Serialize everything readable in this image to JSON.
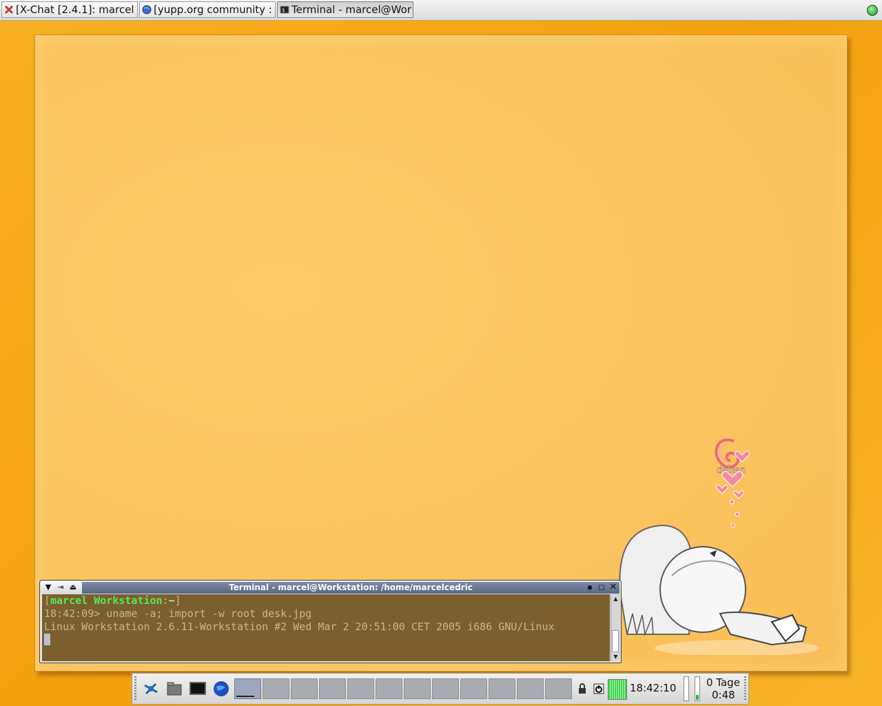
{
  "taskbar": {
    "tasks": [
      {
        "label": "[X-Chat [2.4.1]: marcel",
        "icon": "xchat-icon",
        "active": false
      },
      {
        "label": "[yupp.org community :",
        "icon": "globe-icon",
        "active": false
      },
      {
        "label": "Terminal - marcel@Wor",
        "icon": "terminal-icon",
        "active": true
      }
    ],
    "tray_icon": "status-ball-icon"
  },
  "desktop": {
    "wallpaper_logo_text": "debian",
    "accent_colors": {
      "orange": "#f6a818",
      "panel": "#fbc45e"
    }
  },
  "terminal": {
    "title": "Terminal - marcel@Workstation: /home/marcelcedric",
    "prompt": {
      "open_bracket": "[",
      "user": "marcel",
      "space": " ",
      "host": "Workstation",
      "sep": ":",
      "path": "~",
      "close_bracket": "]"
    },
    "command_line": "18:42:09> uname -a; import -w root desk.jpg",
    "output_line": "Linux Workstation 2.6.11-Workstation #2 Wed Mar 2 20:51:00 CET 2005 i686 GNU/Linux",
    "titlebar_buttons": [
      "menu",
      "shade",
      "stick",
      "minimize",
      "maximize",
      "close"
    ]
  },
  "panel": {
    "launchers": [
      "xfce-mouse-icon",
      "file-manager-icon",
      "terminal-icon",
      "browser-globe-icon"
    ],
    "workspaces": 12,
    "active_workspace": 1,
    "clock": "18:42:10",
    "uptime_days": "0 Tage",
    "uptime_time": "0:48",
    "tray": [
      "lock-icon",
      "power-icon",
      "cpu-graph",
      "battery"
    ],
    "battery_level": 0.2
  }
}
